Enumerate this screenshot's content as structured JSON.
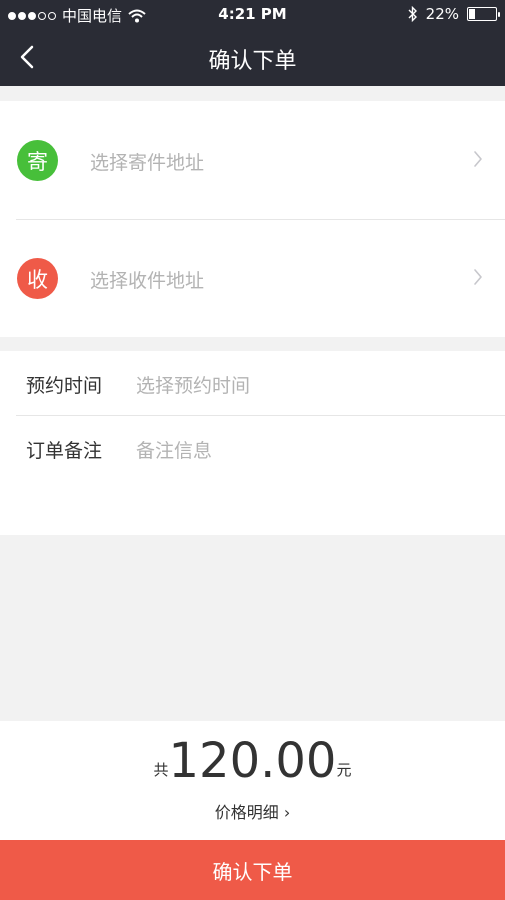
{
  "status_bar": {
    "carrier": "中国电信",
    "time": "4:21 PM",
    "battery_percent": "22%",
    "battery_level": 0.22,
    "signal_bars_filled": 3,
    "signal_bars_total": 5,
    "icons": [
      "wifi-icon",
      "bluetooth-icon",
      "battery-icon"
    ]
  },
  "nav": {
    "title": "确认下单",
    "back_icon": "chevron-left-icon"
  },
  "address": {
    "send": {
      "badge": "寄",
      "placeholder": "选择寄件地址"
    },
    "receive": {
      "badge": "收",
      "placeholder": "选择收件地址"
    }
  },
  "order_info": {
    "time_label": "预约时间",
    "time_placeholder": "选择预约时间",
    "note_label": "订单备注",
    "note_placeholder": "备注信息"
  },
  "total": {
    "prefix": "共",
    "amount": "120.00",
    "unit": "元",
    "detail_label": "价格明细 ›"
  },
  "confirm_button": "确认下单",
  "colors": {
    "header_bg": "#2a2c35",
    "send_badge": "#47bf3a",
    "receive_badge": "#ef5a48",
    "confirm_bg": "#ef5a48",
    "placeholder_text": "#b3b3b3"
  }
}
